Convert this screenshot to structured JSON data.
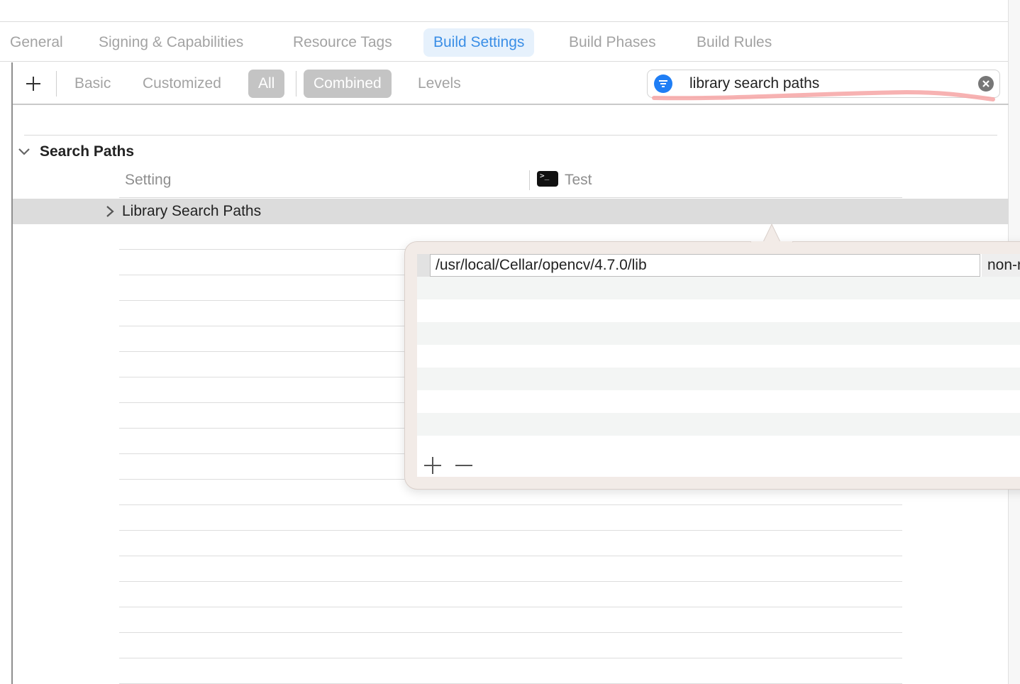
{
  "tabs": [
    {
      "label": "General"
    },
    {
      "label": "Signing & Capabilities"
    },
    {
      "label": "Resource Tags"
    },
    {
      "label": "Build Settings"
    },
    {
      "label": "Build Phases"
    },
    {
      "label": "Build Rules"
    }
  ],
  "active_tab": "Build Settings",
  "filter": {
    "scope": [
      "Basic",
      "Customized",
      "All"
    ],
    "selected_scope": "All",
    "view": [
      "Combined",
      "Levels"
    ],
    "selected_view": "Combined"
  },
  "search": {
    "value": "library search paths"
  },
  "section": {
    "title": "Search Paths"
  },
  "columns": {
    "setting": "Setting",
    "target": "Test"
  },
  "row": {
    "label": "Library Search Paths"
  },
  "popover": {
    "path": "/usr/local/Cellar/opencv/4.7.0/lib",
    "type": "non-recursive"
  },
  "colors": {
    "accent": "#1f7ef5",
    "active_tab_bg": "#e6f1fc",
    "active_tab_text": "#3a8ee6",
    "selected_segment": "#c4c4c4",
    "highlight_annotation": "#f6a5a5"
  }
}
